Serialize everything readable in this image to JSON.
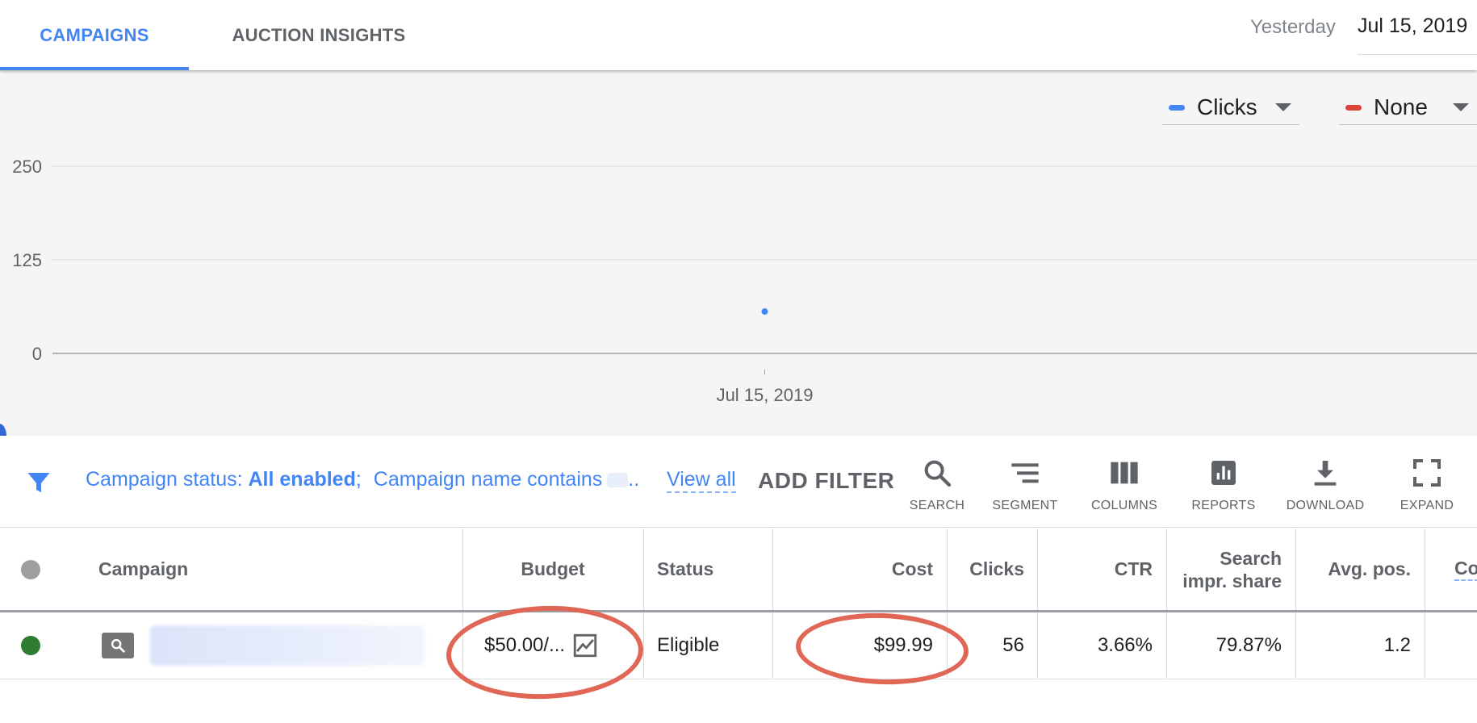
{
  "tabs": [
    {
      "label": "CAMPAIGNS",
      "active": true
    },
    {
      "label": "AUCTION INSIGHTS",
      "active": false
    }
  ],
  "date_range": {
    "label": "Yesterday",
    "value": "Jul 15, 2019"
  },
  "metrics": [
    {
      "label": "Clicks",
      "color": "#4285f4"
    },
    {
      "label": "None",
      "color": "#db4437"
    }
  ],
  "chart_data": {
    "type": "scatter",
    "series": [
      {
        "name": "Clicks",
        "x": [
          "Jul 15, 2019"
        ],
        "y": [
          56
        ],
        "color": "#4285f4"
      }
    ],
    "x_ticks": [
      "Jul 15, 2019"
    ],
    "y_ticks": [
      0,
      125,
      250
    ],
    "ylim": [
      0,
      250
    ],
    "grid": true
  },
  "filter": {
    "prefix": "Campaign status: ",
    "status_value": "All enabled",
    "separator": ";",
    "name_condition": "Campaign name contains",
    "ellipsis": "..",
    "view_all": "View all",
    "add_filter": "ADD FILTER"
  },
  "toolbar": [
    {
      "label": "SEARCH",
      "icon": "search-icon"
    },
    {
      "label": "SEGMENT",
      "icon": "segment-icon"
    },
    {
      "label": "COLUMNS",
      "icon": "columns-icon"
    },
    {
      "label": "REPORTS",
      "icon": "reports-icon"
    },
    {
      "label": "DOWNLOAD",
      "icon": "download-icon"
    },
    {
      "label": "EXPAND",
      "icon": "expand-icon"
    }
  ],
  "table": {
    "headers": {
      "campaign": "Campaign",
      "budget": "Budget",
      "status": "Status",
      "cost": "Cost",
      "clicks": "Clicks",
      "ctr": "CTR",
      "search_impr_share_line1": "Search",
      "search_impr_share_line2": "impr. share",
      "avg_pos": "Avg. pos.",
      "conversions_partial": "Co"
    },
    "rows": [
      {
        "status_color": "#2e7d32",
        "budget": "$50.00/...",
        "status": "Eligible",
        "cost": "$99.99",
        "clicks": "56",
        "ctr": "3.66%",
        "search_impr_share": "79.87%",
        "avg_pos": "1.2"
      }
    ]
  },
  "colors": {
    "accent": "#4285f4",
    "annotation": "#e06656",
    "enabled_dot": "#2e7d32",
    "header_dot": "#9e9e9e"
  }
}
